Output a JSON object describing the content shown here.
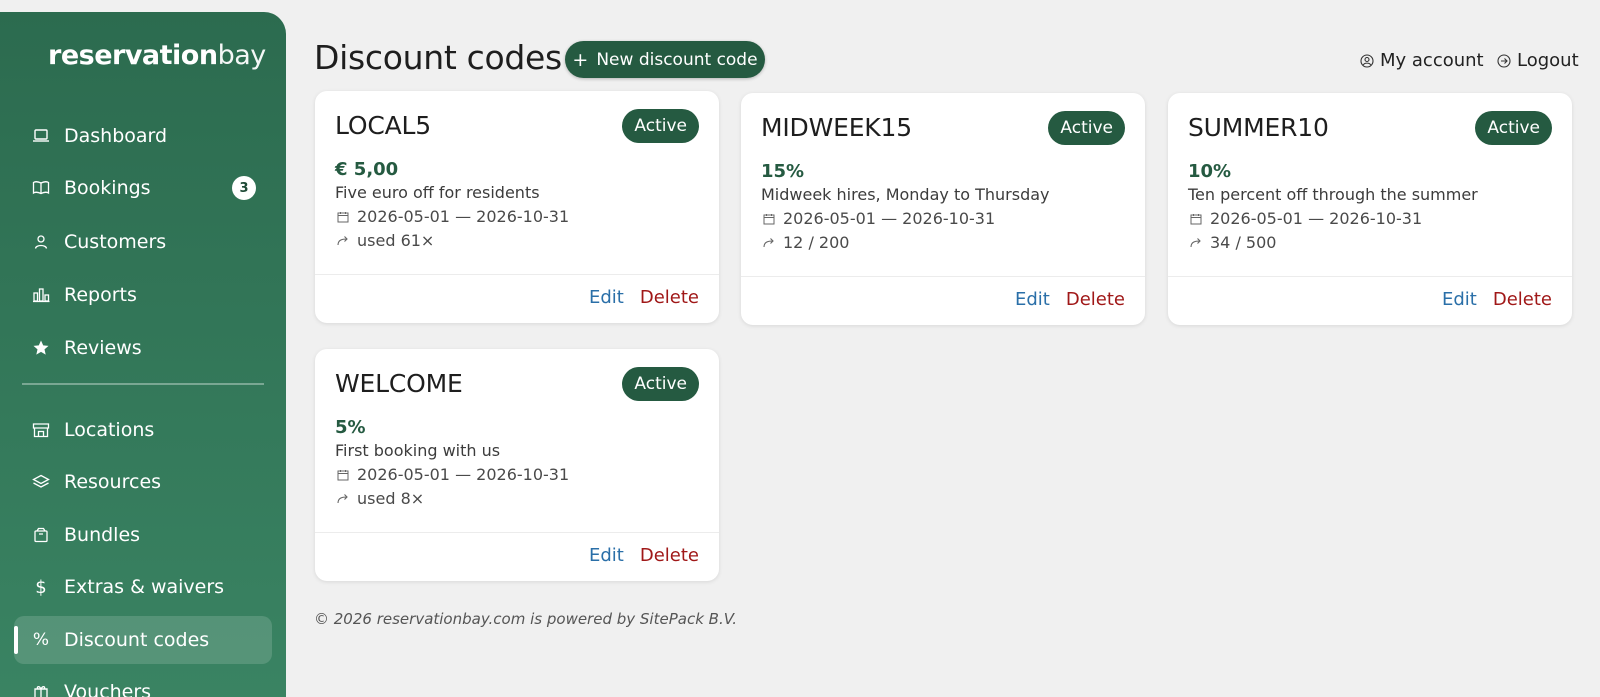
{
  "brand": {
    "part1": "reservation",
    "part2": "bay"
  },
  "sidebar": {
    "items": [
      {
        "label": "Dashboard",
        "icon": "laptop-icon"
      },
      {
        "label": "Bookings",
        "icon": "book-icon",
        "badge": "3"
      },
      {
        "label": "Customers",
        "icon": "user-icon"
      },
      {
        "label": "Reports",
        "icon": "bar-chart-icon"
      },
      {
        "label": "Reviews",
        "icon": "star-icon"
      },
      {
        "label": "Locations",
        "icon": "store-icon"
      },
      {
        "label": "Resources",
        "icon": "layers-icon"
      },
      {
        "label": "Bundles",
        "icon": "package-icon"
      },
      {
        "label": "Extras & waivers",
        "icon": "dollar-icon"
      },
      {
        "label": "Discount codes",
        "icon": "percent-icon",
        "active": true
      },
      {
        "label": "Vouchers",
        "icon": "gift-icon"
      }
    ]
  },
  "header": {
    "title": "Discount codes",
    "new_button": "New discount code",
    "account_label": "My account",
    "logout_label": "Logout"
  },
  "cards": [
    {
      "code": "LOCAL5",
      "status": "Active",
      "amount": "€ 5,00",
      "description": "Five euro off for residents",
      "dates": "2026-05-01 — 2026-10-31",
      "usage": "used 61×",
      "edit": "Edit",
      "delete": "Delete"
    },
    {
      "code": "MIDWEEK15",
      "status": "Active",
      "amount": "15%",
      "description": "Midweek hires, Monday to Thursday",
      "dates": "2026-05-01 — 2026-10-31",
      "usage": "12 / 200",
      "edit": "Edit",
      "delete": "Delete"
    },
    {
      "code": "SUMMER10",
      "status": "Active",
      "amount": "10%",
      "description": "Ten percent off through the summer",
      "dates": "2026-05-01 — 2026-10-31",
      "usage": "34 / 500",
      "edit": "Edit",
      "delete": "Delete"
    },
    {
      "code": "WELCOME",
      "status": "Active",
      "amount": "5%",
      "description": "First booking with us",
      "dates": "2026-05-01 — 2026-10-31",
      "usage": "used 8×",
      "edit": "Edit",
      "delete": "Delete"
    }
  ],
  "footer": "© 2026 reservationbay.com is powered by SitePack B.V.",
  "colors": {
    "sidebar": "#2c6b4f",
    "accent": "#255a41",
    "edit": "#2a6fa8",
    "delete": "#a01818"
  }
}
